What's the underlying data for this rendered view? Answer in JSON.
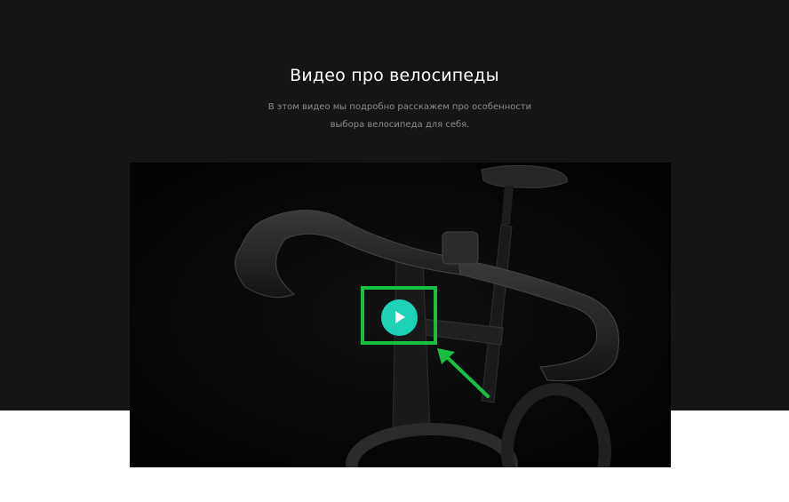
{
  "section": {
    "title": "Видео про велосипеды",
    "subtitle": "В этом видео мы подробно расскажем про особенности выбора велосипеда для себя."
  },
  "video": {
    "play_icon": "play-icon",
    "play_button_color": "#1ed3b5"
  },
  "annotation": {
    "highlight_color": "#16c141",
    "arrow_icon": "arrow-icon"
  },
  "colors": {
    "dark_background": "#151515",
    "light_background": "#ffffff",
    "title_text": "#ffffff",
    "subtitle_text": "#8c8c8c"
  }
}
